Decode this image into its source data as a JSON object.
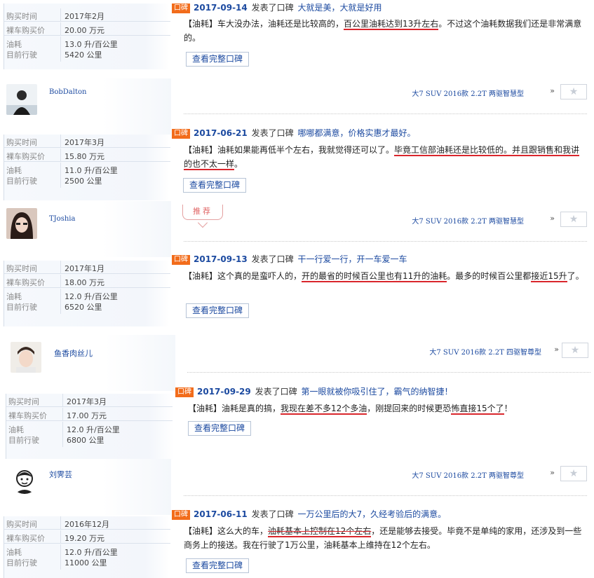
{
  "labels": {
    "purchase_time": "购买时间",
    "bare_price": "裸车购买价",
    "fuel": "油耗",
    "mileage": "目前行驶",
    "published": "发表了口碑",
    "tag": "口碑",
    "view_full": "查看完整口碑",
    "star": "★",
    "arrows": "»",
    "recommend": "推荐"
  },
  "cards": [
    {
      "info": {
        "purchase_time": "2017年2月",
        "price": "20.00 万元",
        "fuel": "13.0 升/百公里",
        "mileage": "5420 公里"
      },
      "review": {
        "date": "2017-09-14",
        "title": "大就是美，大就是好用",
        "seg1": "【油耗】车大没办法，油耗还是比较高的，",
        "mark1": "百公里油耗达到13升左右",
        "seg2": "。不过这个油耗数据我们还是非常满意的。"
      }
    },
    {
      "user": "BobDalton",
      "model": "大7 SUV 2016款 2.2T 两驱智慧型",
      "info": {
        "purchase_time": "2017年3月",
        "price": "15.80 万元",
        "fuel": "11.0 升/百公里",
        "mileage": "2500 公里"
      },
      "review": {
        "date": "2017-06-21",
        "title": "哪哪都满意，价格实惠才最好。",
        "seg1": "【油耗】油耗如果能再低半个左右，我就觉得还可以了。",
        "mark1": "毕竟工信部油耗还是比较低的。并且跟销售和我讲的也不太一样",
        "seg2": "。"
      }
    },
    {
      "user": "TJoshia",
      "model": "大7 SUV 2016款 2.2T 两驱智慧型",
      "info": {
        "purchase_time": "2017年1月",
        "price": "18.00 万元",
        "fuel": "12.0 升/百公里",
        "mileage": "6520 公里"
      },
      "review": {
        "date": "2017-09-13",
        "title": "干一行爱一行，开一车爱一车",
        "seg1": "【油耗】这个真的是蛮吓人的，",
        "mark1": "开的最省的时候百公里也有11升的油耗",
        "seg2": "。最多的时候百公里都",
        "mark2": "接近15升",
        "seg3": "了。"
      }
    },
    {
      "user": "鱼香肉丝儿",
      "model": "大7 SUV 2016款 2.2T 四驱智尊型",
      "info": {
        "purchase_time": "2017年3月",
        "price": "17.00 万元",
        "fuel": "12.0 升/百公里",
        "mileage": "6800 公里"
      },
      "review": {
        "date": "2017-09-29",
        "title": "第一眼就被你吸引住了，霸气的纳智捷！",
        "seg1": "【油耗】油耗是真的搞，",
        "mark1": "我现在差不多12个多油",
        "seg2": "，刚提回来的时候更恐",
        "mark2": "怖直接15个了",
        "seg3": "！"
      }
    },
    {
      "user": "刘霁芸",
      "model": "大7 SUV 2016款 2.2T 两驱智尊型",
      "info": {
        "purchase_time": "2016年12月",
        "price": "19.20 万元",
        "fuel": "12.0 升/百公里",
        "mileage": "11000 公里"
      },
      "review": {
        "date": "2017-06-11",
        "title": "一万公里后的大7，久经考验后的满意。",
        "seg1": "【油耗】这么大的车，",
        "mark1": "油耗基本上控制在12个左右",
        "seg2": "，还是能够去接受。毕竟不是单纯的家用，还涉及到一些商务上的接送。我在行驶了1万公里，油耗基本上维持在12个左右。"
      }
    }
  ]
}
